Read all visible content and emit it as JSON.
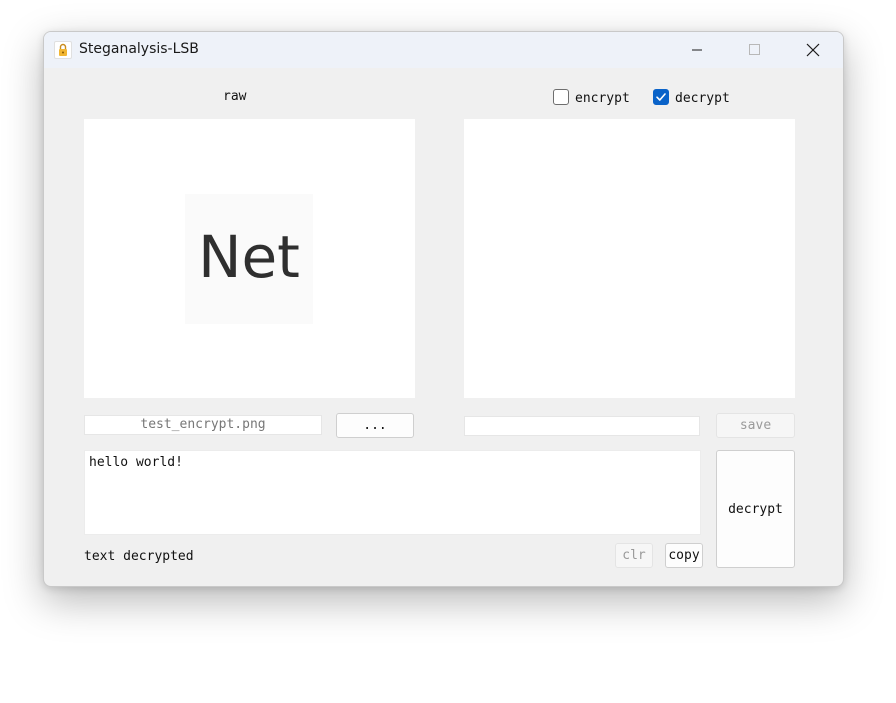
{
  "window": {
    "title": "Steganalysis-LSB",
    "icon": "lock-icon"
  },
  "left": {
    "label": "raw",
    "image_text": "Net",
    "file_value": "test_encrypt.png",
    "browse_label": "..."
  },
  "right": {
    "encrypt_label": "encrypt",
    "encrypt_checked": false,
    "decrypt_label": "decrypt",
    "decrypt_checked": true,
    "file_value": "",
    "save_label": "save"
  },
  "message": {
    "text": "hello world!",
    "status": "text decrypted",
    "clear_label": "clr",
    "copy_label": "copy",
    "action_label": "decrypt"
  },
  "colors": {
    "accent": "#0a63c9",
    "titlebar": "#eef2f9",
    "window_bg": "#f0f0f0"
  }
}
